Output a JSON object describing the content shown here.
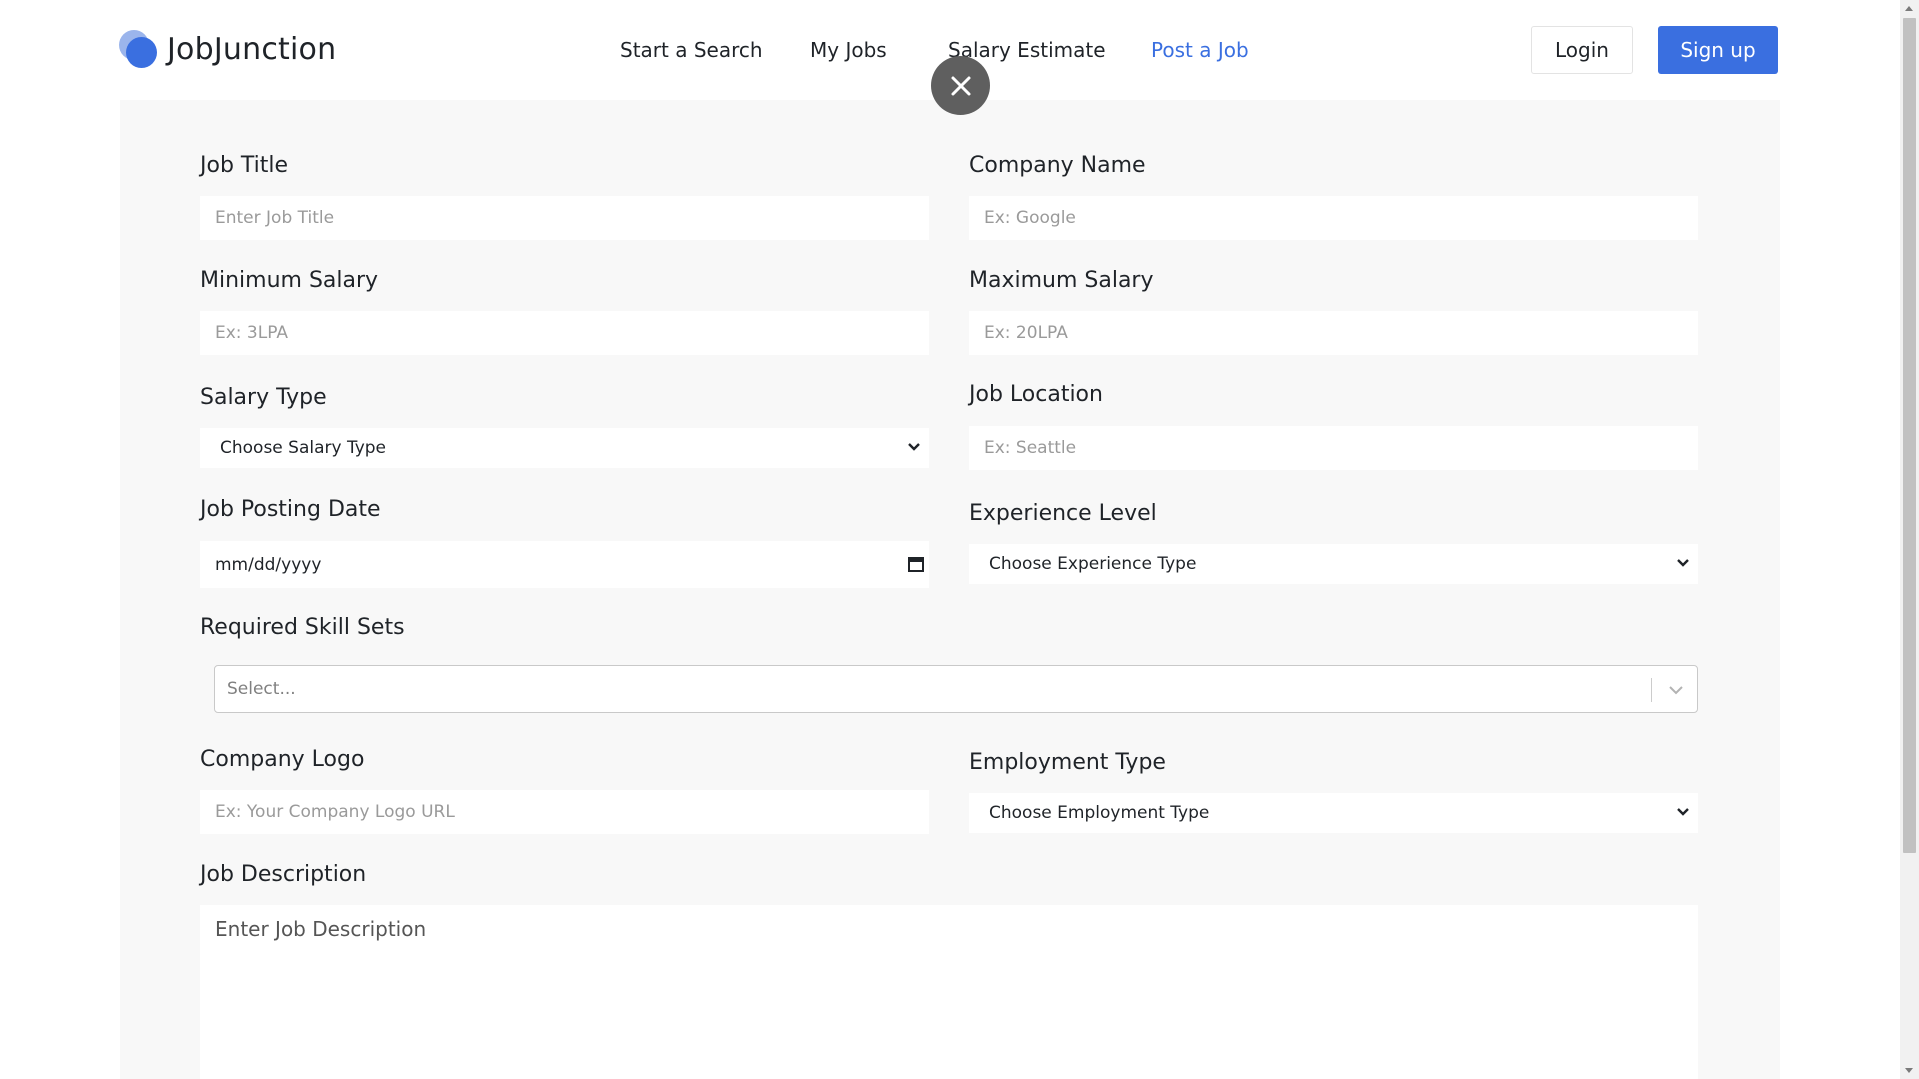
{
  "brand": {
    "name": "JobJunction"
  },
  "nav": {
    "items": [
      {
        "label": "Start a Search"
      },
      {
        "label": "My Jobs"
      },
      {
        "label": "Salary Estimate"
      },
      {
        "label": "Post a Job"
      }
    ],
    "active": "Post a Job",
    "active_color": "#3a6fe0"
  },
  "auth": {
    "login_label": "Login",
    "signup_label": "Sign up",
    "signup_color": "#3a6fe0"
  },
  "form": {
    "job_title": {
      "label": "Job Title",
      "placeholder": "Enter Job Title"
    },
    "company_name": {
      "label": "Company Name",
      "placeholder": "Ex: Google"
    },
    "min_salary": {
      "label": "Minimum Salary",
      "placeholder": "Ex: 3LPA"
    },
    "max_salary": {
      "label": "Maximum Salary",
      "placeholder": "Ex: 20LPA"
    },
    "salary_type": {
      "label": "Salary Type",
      "selected": "Choose Salary Type"
    },
    "job_location": {
      "label": "Job Location",
      "placeholder": "Ex: Seattle"
    },
    "posting_date": {
      "label": "Job Posting Date",
      "value": "mm/dd/yyyy"
    },
    "experience_level": {
      "label": "Experience Level",
      "selected": "Choose Experience Type"
    },
    "skills": {
      "label": "Required Skill Sets",
      "placeholder": "Select..."
    },
    "company_logo": {
      "label": "Company Logo",
      "placeholder": "Ex: Your Company Logo URL"
    },
    "employment_type": {
      "label": "Employment Type",
      "selected": "Choose Employment Type"
    },
    "description": {
      "label": "Job Description",
      "placeholder": "Enter Job Description"
    }
  },
  "icons": {
    "close": "close-icon",
    "chevron": "chevron-down-icon",
    "calendar": "calendar-icon"
  }
}
